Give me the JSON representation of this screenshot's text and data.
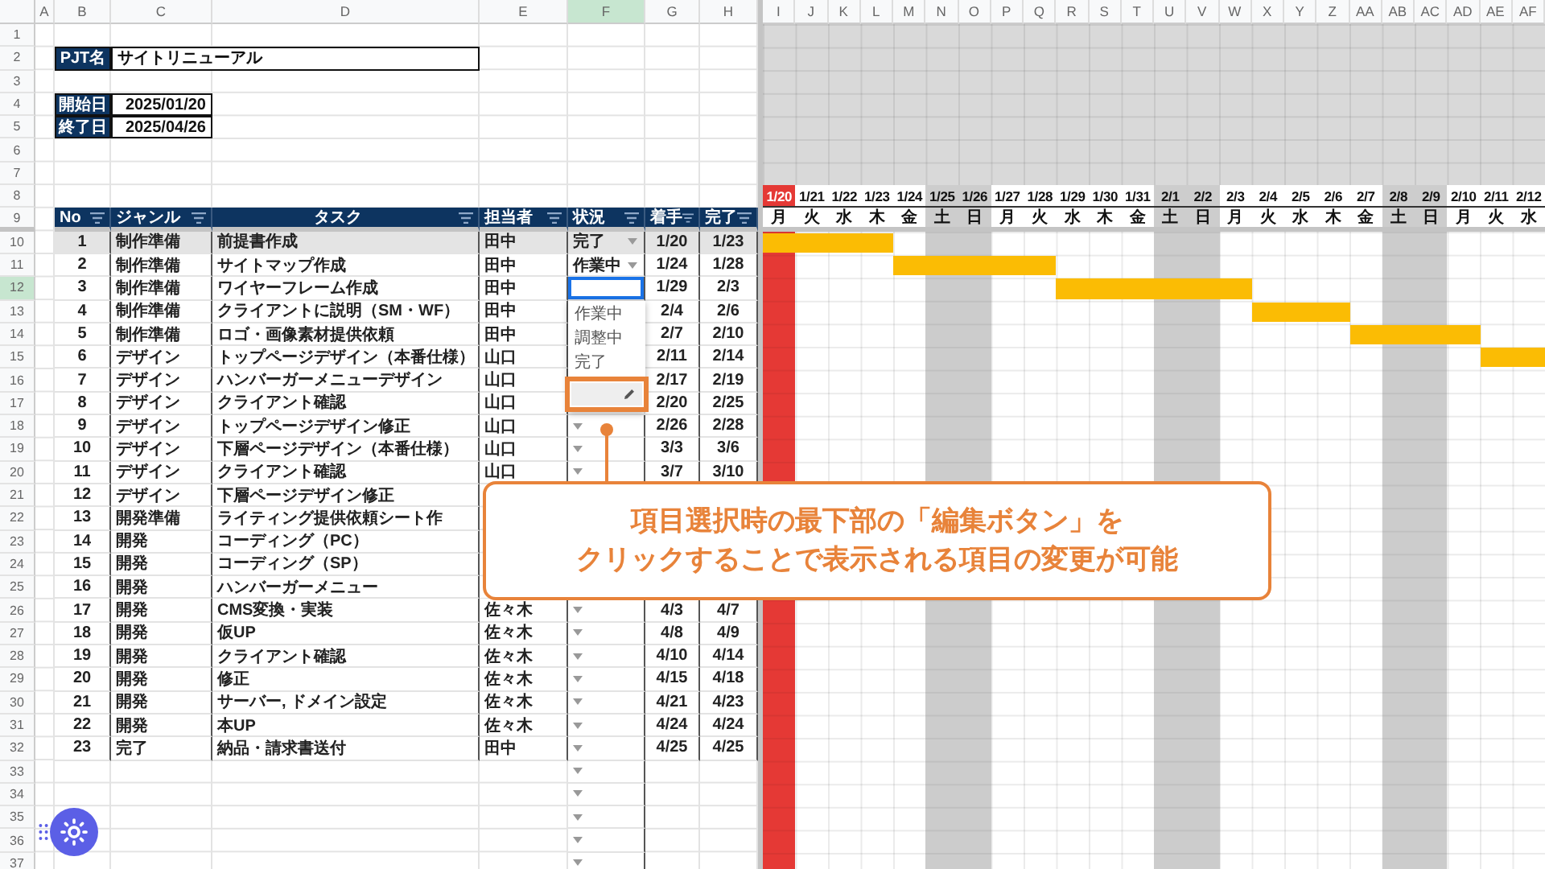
{
  "column_headers": [
    {
      "label": "A",
      "selected": false
    },
    {
      "label": "B",
      "selected": false
    },
    {
      "label": "C",
      "selected": false
    },
    {
      "label": "D",
      "selected": false
    },
    {
      "label": "E",
      "selected": false
    },
    {
      "label": "F",
      "selected": true
    },
    {
      "label": "G",
      "selected": false
    },
    {
      "label": "H",
      "selected": false
    },
    {
      "label": "I",
      "selected": false
    },
    {
      "label": "J",
      "selected": false
    },
    {
      "label": "K",
      "selected": false
    },
    {
      "label": "L",
      "selected": false
    },
    {
      "label": "M",
      "selected": false
    },
    {
      "label": "N",
      "selected": false
    },
    {
      "label": "O",
      "selected": false
    },
    {
      "label": "P",
      "selected": false
    },
    {
      "label": "Q",
      "selected": false
    },
    {
      "label": "R",
      "selected": false
    },
    {
      "label": "S",
      "selected": false
    },
    {
      "label": "T",
      "selected": false
    },
    {
      "label": "U",
      "selected": false
    },
    {
      "label": "V",
      "selected": false
    },
    {
      "label": "W",
      "selected": false
    },
    {
      "label": "X",
      "selected": false
    },
    {
      "label": "Y",
      "selected": false
    },
    {
      "label": "Z",
      "selected": false
    },
    {
      "label": "AA",
      "selected": false
    },
    {
      "label": "AB",
      "selected": false
    },
    {
      "label": "AC",
      "selected": false
    },
    {
      "label": "AD",
      "selected": false
    },
    {
      "label": "AE",
      "selected": false
    },
    {
      "label": "AF",
      "selected": false
    }
  ],
  "row_numbers": [
    {
      "label": "1",
      "selected": false
    },
    {
      "label": "2",
      "selected": false
    },
    {
      "label": "3",
      "selected": false
    },
    {
      "label": "4",
      "selected": false
    },
    {
      "label": "5",
      "selected": false
    },
    {
      "label": "6",
      "selected": false
    },
    {
      "label": "7",
      "selected": false
    },
    {
      "label": "8",
      "selected": false
    },
    {
      "label": "9",
      "selected": false
    },
    {
      "label": "10",
      "selected": false
    },
    {
      "label": "11",
      "selected": false
    },
    {
      "label": "12",
      "selected": true
    },
    {
      "label": "13",
      "selected": false
    },
    {
      "label": "14",
      "selected": false
    },
    {
      "label": "15",
      "selected": false
    },
    {
      "label": "16",
      "selected": false
    },
    {
      "label": "17",
      "selected": false
    },
    {
      "label": "18",
      "selected": false
    },
    {
      "label": "19",
      "selected": false
    },
    {
      "label": "20",
      "selected": false
    },
    {
      "label": "21",
      "selected": false
    },
    {
      "label": "22",
      "selected": false
    },
    {
      "label": "23",
      "selected": false
    },
    {
      "label": "24",
      "selected": false
    },
    {
      "label": "25",
      "selected": false
    },
    {
      "label": "26",
      "selected": false
    },
    {
      "label": "27",
      "selected": false
    },
    {
      "label": "28",
      "selected": false
    },
    {
      "label": "29",
      "selected": false
    },
    {
      "label": "30",
      "selected": false
    },
    {
      "label": "31",
      "selected": false
    },
    {
      "label": "32",
      "selected": false
    },
    {
      "label": "33",
      "selected": false
    },
    {
      "label": "34",
      "selected": false
    },
    {
      "label": "35",
      "selected": false
    },
    {
      "label": "36",
      "selected": false
    },
    {
      "label": "37",
      "selected": false
    }
  ],
  "project": {
    "label": "PJT名",
    "value": "サイトリニューアル"
  },
  "period": [
    {
      "label": "開始日",
      "value": "2025/01/20"
    },
    {
      "label": "終了日",
      "value": "2025/04/26"
    }
  ],
  "table": {
    "columns": [
      "No",
      "ジャンル",
      "タスク",
      "担当者",
      "状況",
      "着手",
      "完了"
    ],
    "rows": [
      {
        "no": "1",
        "genre": "制作準備",
        "task": "前提書作成",
        "owner": "田中",
        "status": "完了",
        "start": "1/20",
        "end": "1/23",
        "dropdown": true,
        "selected": false,
        "highlighted": true
      },
      {
        "no": "2",
        "genre": "制作準備",
        "task": "サイトマップ作成",
        "owner": "田中",
        "status": "作業中",
        "start": "1/24",
        "end": "1/28",
        "dropdown": true,
        "selected": false,
        "highlighted": false
      },
      {
        "no": "3",
        "genre": "制作準備",
        "task": "ワイヤーフレーム作成",
        "owner": "田中",
        "start": "1/29",
        "end": "2/3",
        "dropdown": false,
        "selected": true,
        "highlighted": false
      },
      {
        "no": "4",
        "genre": "制作準備",
        "task": "クライアントに説明（SM・WF）",
        "owner": "田中",
        "start": "2/4",
        "end": "2/6",
        "dropdown": false,
        "selected": false,
        "highlighted": false
      },
      {
        "no": "5",
        "genre": "制作準備",
        "task": "ロゴ・画像素材提供依頼",
        "owner": "田中",
        "start": "2/7",
        "end": "2/10",
        "dropdown": false,
        "selected": false,
        "highlighted": false
      },
      {
        "no": "6",
        "genre": "デザイン",
        "task": "トップページデザイン（本番仕様）",
        "owner": "山口",
        "start": "2/11",
        "end": "2/14",
        "dropdown": false,
        "selected": false,
        "highlighted": false
      },
      {
        "no": "7",
        "genre": "デザイン",
        "task": "ハンバーガーメニューデザイン",
        "owner": "山口",
        "start": "2/17",
        "end": "2/19",
        "dropdown": false,
        "selected": false,
        "highlighted": false
      },
      {
        "no": "8",
        "genre": "デザイン",
        "task": "クライアント確認",
        "owner": "山口",
        "start": "2/20",
        "end": "2/25",
        "dropdown": false,
        "selected": false,
        "highlighted": false
      },
      {
        "no": "9",
        "genre": "デザイン",
        "task": "トップページデザイン修正",
        "owner": "山口",
        "start": "2/26",
        "end": "2/28",
        "dropdown": true,
        "selected": false,
        "highlighted": false
      },
      {
        "no": "10",
        "genre": "デザイン",
        "task": "下層ページデザイン（本番仕様）",
        "owner": "山口",
        "start": "3/3",
        "end": "3/6",
        "dropdown": true,
        "selected": false,
        "highlighted": false
      },
      {
        "no": "11",
        "genre": "デザイン",
        "task": "クライアント確認",
        "owner": "山口",
        "start": "3/7",
        "end": "3/10",
        "dropdown": true,
        "selected": false,
        "highlighted": false
      },
      {
        "no": "12",
        "genre": "デザイン",
        "task": "下層ページデザイン修正",
        "dropdown": false,
        "selected": false,
        "highlighted": false
      },
      {
        "no": "13",
        "genre": "開発準備",
        "task": "ライティング提供依頼シート作",
        "dropdown": false,
        "selected": false,
        "highlighted": false
      },
      {
        "no": "14",
        "genre": "開発",
        "task": "コーディング（PC）",
        "dropdown": false,
        "selected": false,
        "highlighted": false
      },
      {
        "no": "15",
        "genre": "開発",
        "task": "コーディング（SP）",
        "dropdown": false,
        "selected": false,
        "highlighted": false
      },
      {
        "no": "16",
        "genre": "開発",
        "task": "ハンバーガーメニュー",
        "dropdown": false,
        "selected": false,
        "highlighted": false
      },
      {
        "no": "17",
        "genre": "開発",
        "task": "CMS変換・実装",
        "owner": "佐々木",
        "start": "4/3",
        "end": "4/7",
        "dropdown": true,
        "selected": false,
        "highlighted": false
      },
      {
        "no": "18",
        "genre": "開発",
        "task": "仮UP",
        "owner": "佐々木",
        "start": "4/8",
        "end": "4/9",
        "dropdown": true,
        "selected": false,
        "highlighted": false
      },
      {
        "no": "19",
        "genre": "開発",
        "task": "クライアント確認",
        "owner": "佐々木",
        "start": "4/10",
        "end": "4/14",
        "dropdown": true,
        "selected": false,
        "highlighted": false
      },
      {
        "no": "20",
        "genre": "開発",
        "task": "修正",
        "owner": "佐々木",
        "start": "4/15",
        "end": "4/18",
        "dropdown": true,
        "selected": false,
        "highlighted": false
      },
      {
        "no": "21",
        "genre": "開発",
        "task": "サーバー, ドメイン設定",
        "owner": "佐々木",
        "start": "4/21",
        "end": "4/23",
        "dropdown": true,
        "selected": false,
        "highlighted": false
      },
      {
        "no": "22",
        "genre": "開発",
        "task": "本UP",
        "owner": "佐々木",
        "start": "4/24",
        "end": "4/24",
        "dropdown": true,
        "selected": false,
        "highlighted": false
      },
      {
        "no": "23",
        "genre": "完了",
        "task": "納品・請求書送付",
        "owner": "田中",
        "start": "4/25",
        "end": "4/25",
        "dropdown": true,
        "selected": false,
        "highlighted": false
      },
      {
        "dropdown": true,
        "selected": false,
        "highlighted": false
      },
      {
        "dropdown": true,
        "selected": false,
        "highlighted": false
      },
      {
        "dropdown": true,
        "selected": false,
        "highlighted": false
      },
      {
        "dropdown": true,
        "selected": false,
        "highlighted": false
      },
      {
        "dropdown": true,
        "selected": false,
        "highlighted": false
      }
    ]
  },
  "gantt": {
    "dates": [
      {
        "date": "1/20",
        "weekday": "月",
        "weekend": false,
        "today": true
      },
      {
        "date": "1/21",
        "weekday": "火",
        "weekend": false,
        "today": false
      },
      {
        "date": "1/22",
        "weekday": "水",
        "weekend": false,
        "today": false
      },
      {
        "date": "1/23",
        "weekday": "木",
        "weekend": false,
        "today": false
      },
      {
        "date": "1/24",
        "weekday": "金",
        "weekend": false,
        "today": false
      },
      {
        "date": "1/25",
        "weekday": "土",
        "weekend": true,
        "today": false
      },
      {
        "date": "1/26",
        "weekday": "日",
        "weekend": true,
        "today": false
      },
      {
        "date": "1/27",
        "weekday": "月",
        "weekend": false,
        "today": false
      },
      {
        "date": "1/28",
        "weekday": "火",
        "weekend": false,
        "today": false
      },
      {
        "date": "1/29",
        "weekday": "水",
        "weekend": false,
        "today": false
      },
      {
        "date": "1/30",
        "weekday": "木",
        "weekend": false,
        "today": false
      },
      {
        "date": "1/31",
        "weekday": "金",
        "weekend": false,
        "today": false
      },
      {
        "date": "2/1",
        "weekday": "土",
        "weekend": true,
        "today": false
      },
      {
        "date": "2/2",
        "weekday": "日",
        "weekend": true,
        "today": false
      },
      {
        "date": "2/3",
        "weekday": "月",
        "weekend": false,
        "today": false
      },
      {
        "date": "2/4",
        "weekday": "火",
        "weekend": false,
        "today": false
      },
      {
        "date": "2/5",
        "weekday": "水",
        "weekend": false,
        "today": false
      },
      {
        "date": "2/6",
        "weekday": "木",
        "weekend": false,
        "today": false
      },
      {
        "date": "2/7",
        "weekday": "金",
        "weekend": false,
        "today": false
      },
      {
        "date": "2/8",
        "weekday": "土",
        "weekend": true,
        "today": false
      },
      {
        "date": "2/9",
        "weekday": "日",
        "weekend": true,
        "today": false
      },
      {
        "date": "2/10",
        "weekday": "月",
        "weekend": false,
        "today": false
      },
      {
        "date": "2/11",
        "weekday": "火",
        "weekend": false,
        "today": false
      },
      {
        "date": "2/12",
        "weekday": "水",
        "weekend": false,
        "today": false
      }
    ]
  },
  "dropdown_menu": {
    "options": [
      "作業中",
      "調整中",
      "完了"
    ],
    "edit_button_highlighted": true
  },
  "callout": {
    "lines": [
      "項目選択時の最下部の「編集ボタン」を",
      "クリックすることで表示される項目の変更が可能"
    ]
  }
}
